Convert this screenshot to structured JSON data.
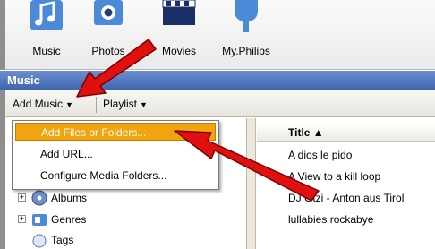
{
  "toolbar": {
    "items": [
      {
        "label": "Music",
        "icon": "music-note-icon"
      },
      {
        "label": "Photos",
        "icon": "camera-icon"
      },
      {
        "label": "Movies",
        "icon": "clapperboard-icon"
      },
      {
        "label": "My.Philips",
        "icon": "philips-icon"
      }
    ]
  },
  "section": {
    "title": "Music"
  },
  "subbar": {
    "add_music": "Add Music",
    "playlist": "Playlist"
  },
  "menu": {
    "items": [
      {
        "label": "Add Files or Folders...",
        "selected": true
      },
      {
        "label": "Add URL..."
      },
      {
        "label": "Configure Media Folders..."
      }
    ]
  },
  "tree": {
    "items": [
      {
        "label": "Albums",
        "icon": "albums-icon"
      },
      {
        "label": "Genres",
        "icon": "genres-icon"
      },
      {
        "label": "Tags",
        "icon": "tags-icon"
      }
    ]
  },
  "tracklist": {
    "header": "Title ▲",
    "tracks": [
      "A dios le pido",
      "A View to a kill loop",
      "DJ Ötzi - Anton aus Tirol",
      "lullabies rockabye"
    ]
  },
  "colors": {
    "accent_red": "#e01010",
    "menu_highlight": "#f1a40e",
    "section_blue": "#4a6fb8"
  }
}
